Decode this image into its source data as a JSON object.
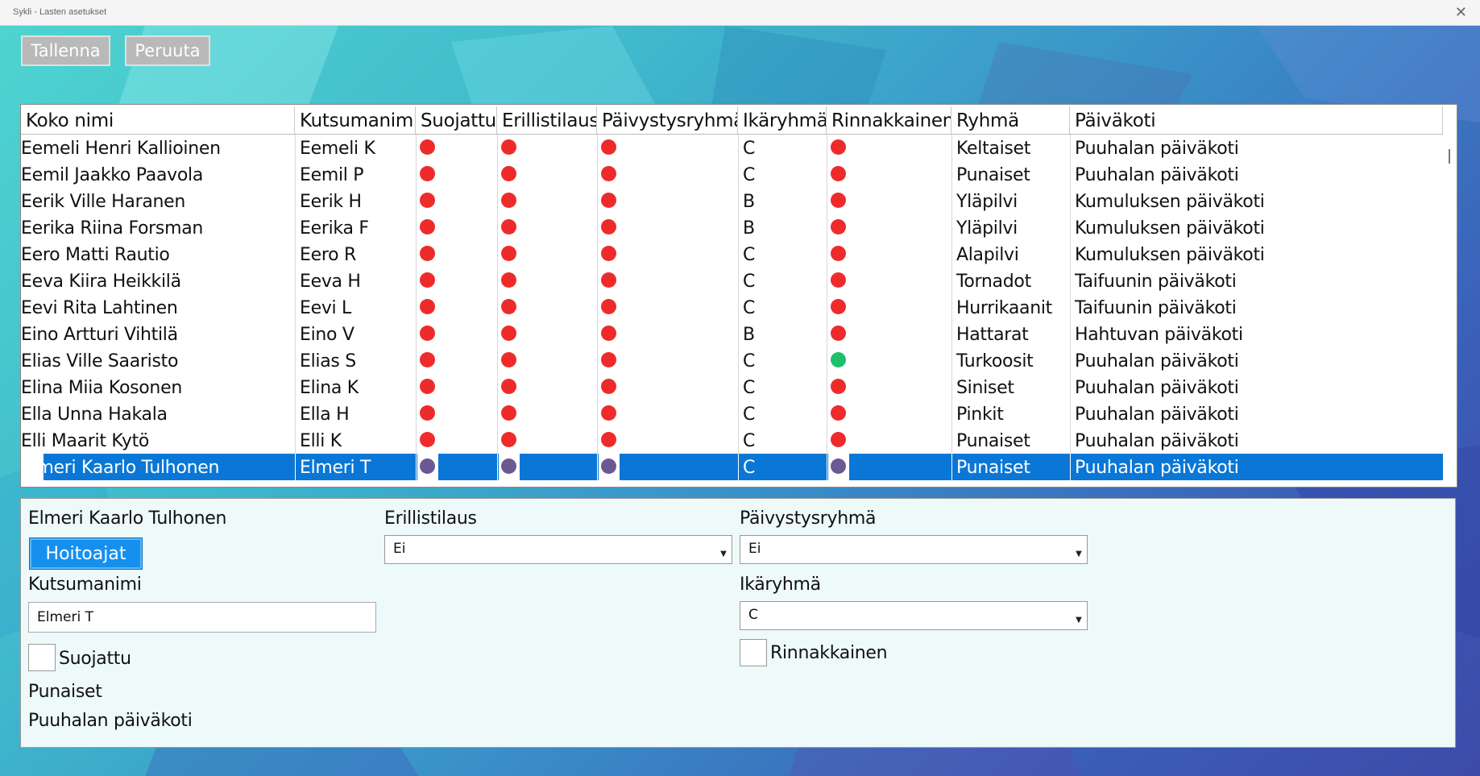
{
  "window": {
    "title": "Sykli - Lasten asetukset",
    "close_glyph": "✕"
  },
  "toolbar": {
    "save_label": "Tallenna",
    "cancel_label": "Peruuta"
  },
  "grid": {
    "columns": [
      "Koko nimi",
      "Kutsumanimi",
      "Suojattu",
      "Erillistilaus",
      "Päivystysryhmä",
      "Ikäryhmä",
      "Rinnakkainen",
      "Ryhmä",
      "Päiväkoti"
    ],
    "selected_index": 12,
    "rows": [
      {
        "name": "Eemeli Henri Kallioinen",
        "nick": "Eemeli K",
        "suojattu": "red",
        "erillis": "red",
        "paivystys": "red",
        "ika": "C",
        "rinnakkainen": "red",
        "ryhma": "Keltaiset",
        "paivakoti": "Puuhalan päiväkoti"
      },
      {
        "name": "Eemil Jaakko Paavola",
        "nick": "Eemil P",
        "suojattu": "red",
        "erillis": "red",
        "paivystys": "red",
        "ika": "C",
        "rinnakkainen": "red",
        "ryhma": "Punaiset",
        "paivakoti": "Puuhalan päiväkoti"
      },
      {
        "name": "Eerik Ville Haranen",
        "nick": "Eerik H",
        "suojattu": "red",
        "erillis": "red",
        "paivystys": "red",
        "ika": "B",
        "rinnakkainen": "red",
        "ryhma": "Yläpilvi",
        "paivakoti": "Kumuluksen päiväkoti"
      },
      {
        "name": "Eerika Riina Forsman",
        "nick": "Eerika F",
        "suojattu": "red",
        "erillis": "red",
        "paivystys": "red",
        "ika": "B",
        "rinnakkainen": "red",
        "ryhma": "Yläpilvi",
        "paivakoti": "Kumuluksen päiväkoti"
      },
      {
        "name": "Eero Matti Rautio",
        "nick": "Eero R",
        "suojattu": "red",
        "erillis": "red",
        "paivystys": "red",
        "ika": "C",
        "rinnakkainen": "red",
        "ryhma": "Alapilvi",
        "paivakoti": "Kumuluksen päiväkoti"
      },
      {
        "name": "Eeva Kiira Heikkilä",
        "nick": "Eeva H",
        "suojattu": "red",
        "erillis": "red",
        "paivystys": "red",
        "ika": "C",
        "rinnakkainen": "red",
        "ryhma": "Tornadot",
        "paivakoti": "Taifuunin päiväkoti"
      },
      {
        "name": "Eevi Rita Lahtinen",
        "nick": "Eevi L",
        "suojattu": "red",
        "erillis": "red",
        "paivystys": "red",
        "ika": "C",
        "rinnakkainen": "red",
        "ryhma": "Hurrikaanit",
        "paivakoti": "Taifuunin päiväkoti"
      },
      {
        "name": "Eino Artturi Vihtilä",
        "nick": "Eino V",
        "suojattu": "red",
        "erillis": "red",
        "paivystys": "red",
        "ika": "B",
        "rinnakkainen": "red",
        "ryhma": "Hattarat",
        "paivakoti": "Hahtuvan päiväkoti"
      },
      {
        "name": "Elias Ville Saaristo",
        "nick": "Elias S",
        "suojattu": "red",
        "erillis": "red",
        "paivystys": "red",
        "ika": "C",
        "rinnakkainen": "green",
        "ryhma": "Turkoosit",
        "paivakoti": "Puuhalan päiväkoti"
      },
      {
        "name": "Elina Miia Kosonen",
        "nick": "Elina K",
        "suojattu": "red",
        "erillis": "red",
        "paivystys": "red",
        "ika": "C",
        "rinnakkainen": "red",
        "ryhma": "Siniset",
        "paivakoti": "Puuhalan päiväkoti"
      },
      {
        "name": "Ella  Unna Hakala",
        "nick": "Ella H",
        "suojattu": "red",
        "erillis": "red",
        "paivystys": "red",
        "ika": "C",
        "rinnakkainen": "red",
        "ryhma": "Pinkit",
        "paivakoti": "Puuhalan päiväkoti"
      },
      {
        "name": "Elli Maarit Kytö",
        "nick": "Elli K",
        "suojattu": "red",
        "erillis": "red",
        "paivystys": "red",
        "ika": "C",
        "rinnakkainen": "red",
        "ryhma": "Punaiset",
        "paivakoti": "Puuhalan päiväkoti"
      },
      {
        "name": "Elmeri Kaarlo Tulhonen",
        "nick": "Elmeri T",
        "suojattu": "purple",
        "erillis": "purple",
        "paivystys": "purple",
        "ika": "C",
        "rinnakkainen": "purple",
        "ryhma": "Punaiset",
        "paivakoti": "Puuhalan päiväkoti"
      }
    ]
  },
  "detail": {
    "full_name": "Elmeri Kaarlo Tulhonen",
    "hoitoajat_label": "Hoitoajat",
    "kutsumanimi_label": "Kutsumanimi",
    "kutsumanimi_value": "Elmeri T",
    "suojattu_label": "Suojattu",
    "ryhma": "Punaiset",
    "paivakoti": "Puuhalan päiväkoti",
    "erillistilaus_label": "Erillistilaus",
    "erillistilaus_value": "Ei",
    "paivystysryhma_label": "Päivystysryhmä",
    "paivystysryhma_value": "Ei",
    "ikaryhma_label": "Ikäryhmä",
    "ikaryhma_value": "C",
    "rinnakkainen_label": "Rinnakkainen",
    "dropdown_arrow": "▼"
  },
  "colors": {
    "dot_red": "#ee2b2b",
    "dot_green": "#1fc06a",
    "dot_selected": "#6c5892",
    "selection": "#0a77d6"
  }
}
